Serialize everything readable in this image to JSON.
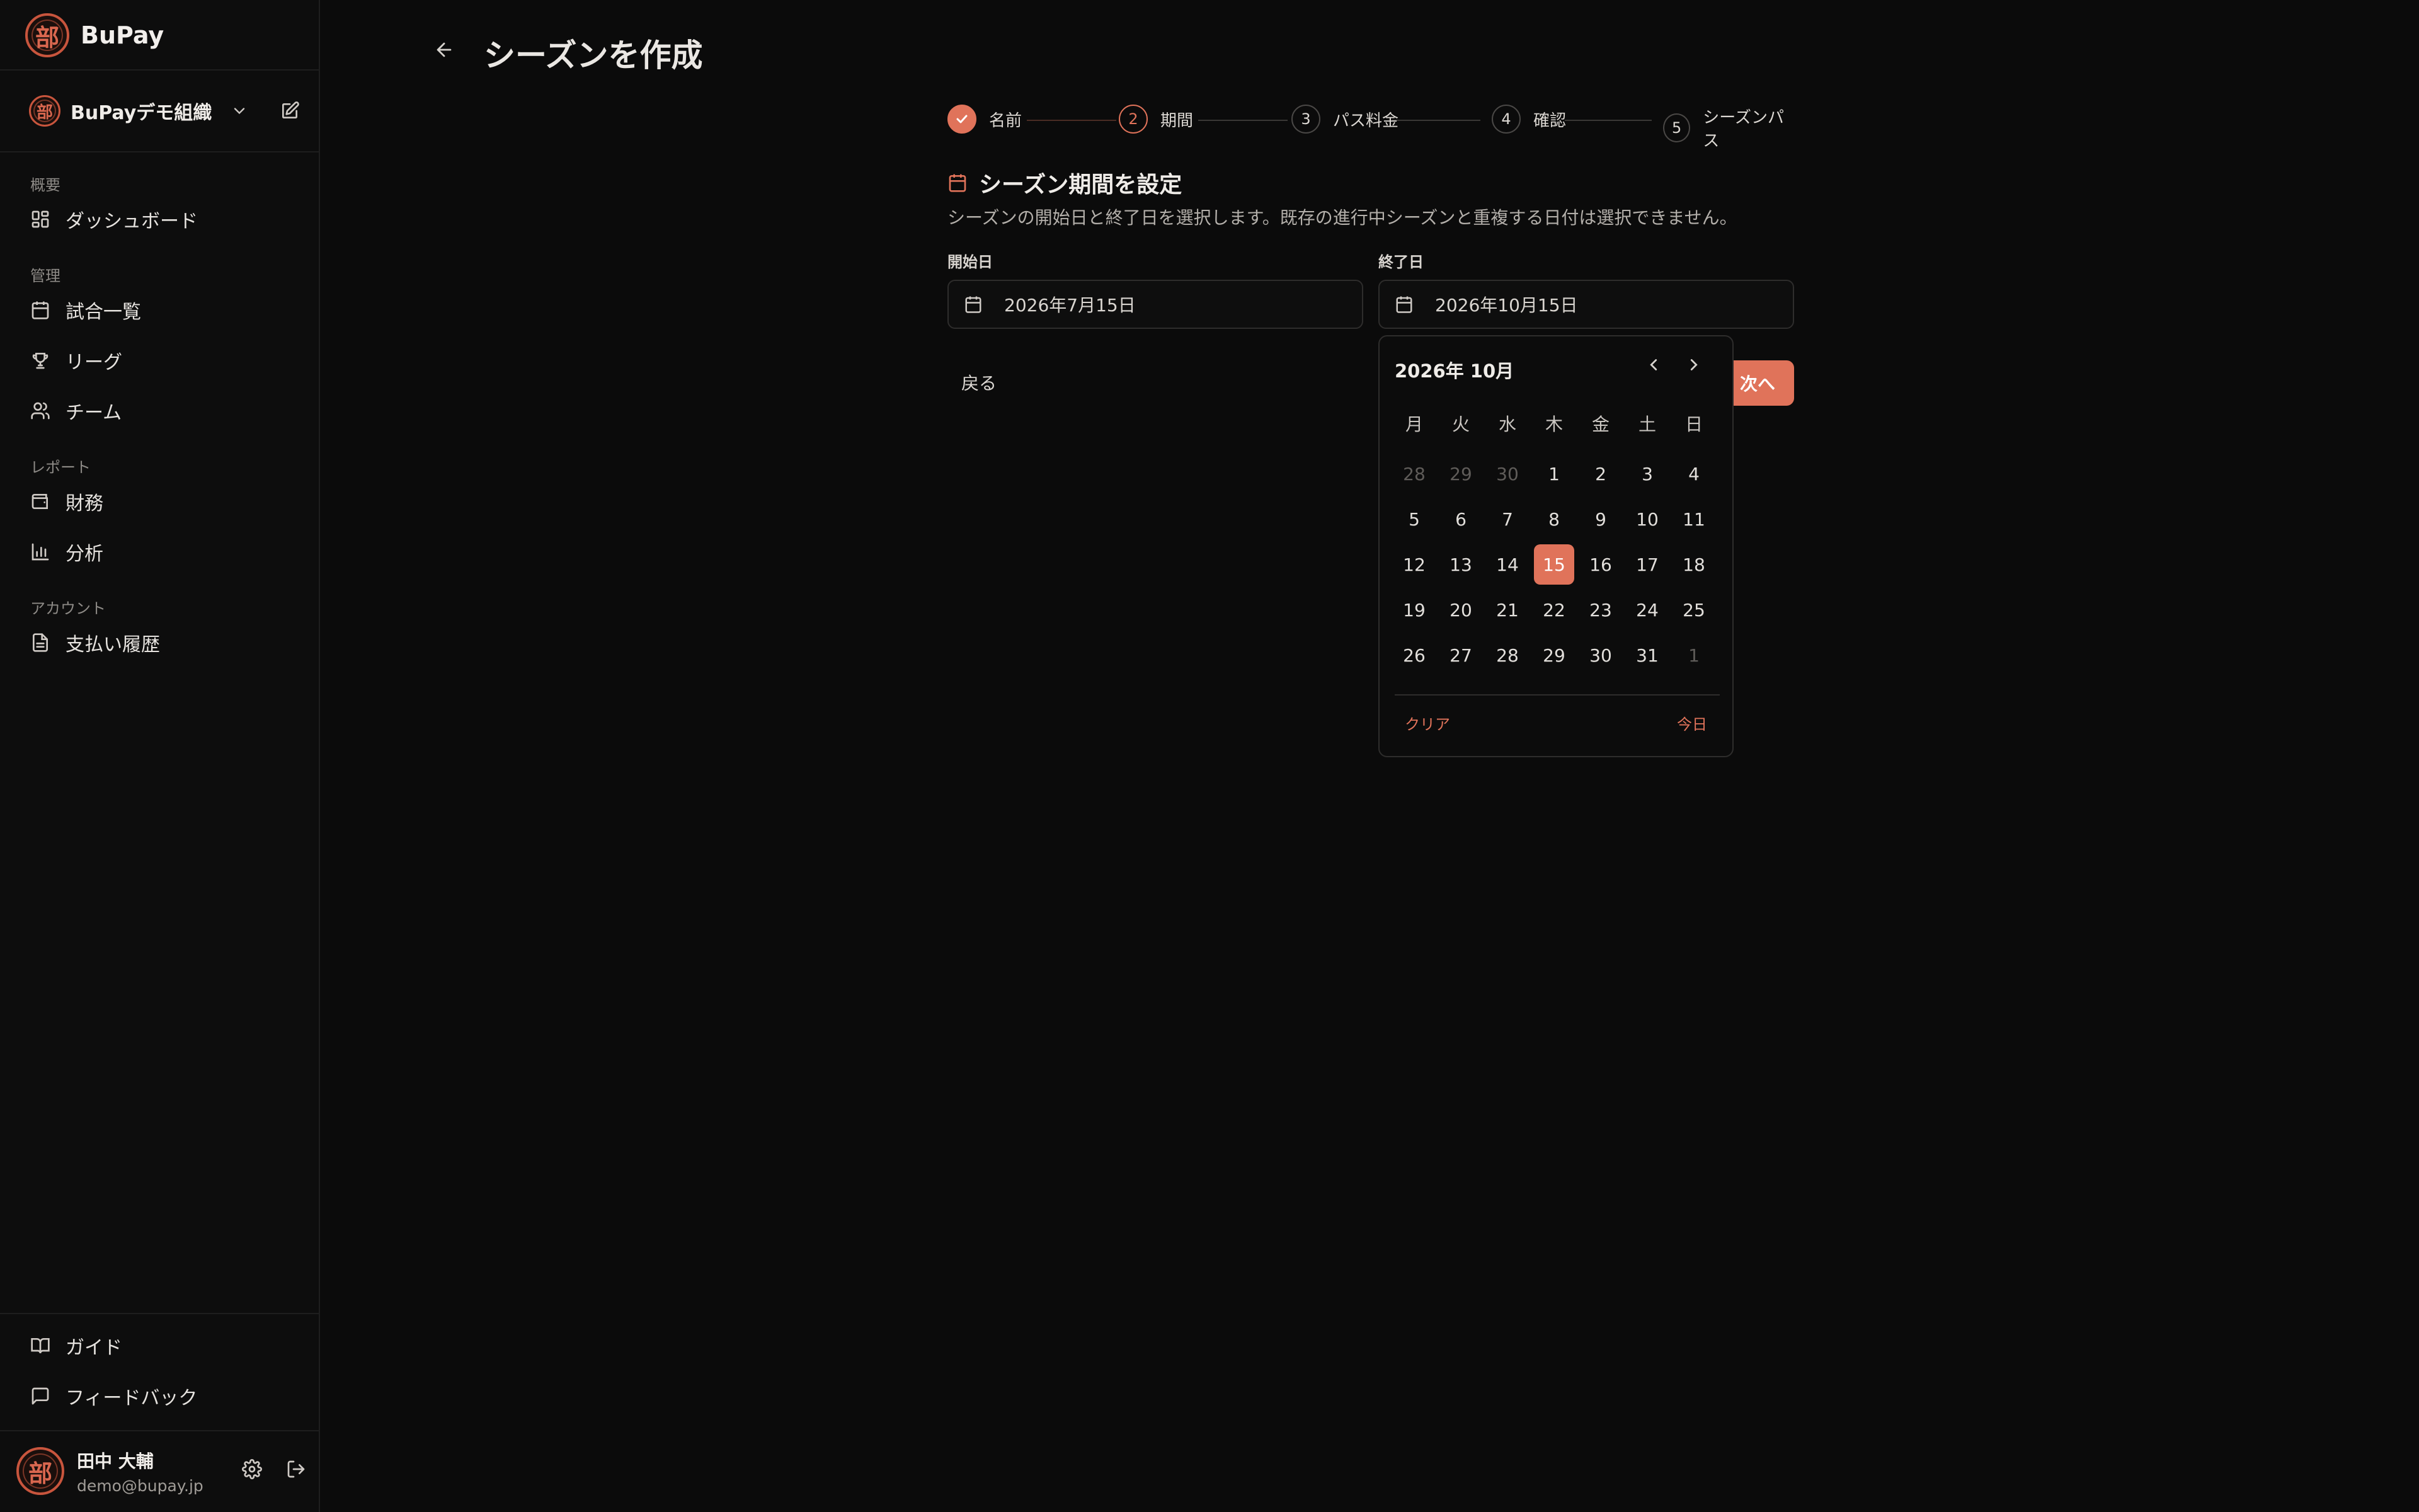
{
  "brand": {
    "name": "BuPay",
    "logo_glyph": "部"
  },
  "org": {
    "name": "BuPayデモ組織"
  },
  "sidebar": {
    "sections": [
      {
        "label": "概要",
        "items": [
          {
            "label": "ダッシュボード",
            "icon": "dashboard-icon"
          }
        ]
      },
      {
        "label": "管理",
        "items": [
          {
            "label": "試合一覧",
            "icon": "calendar-icon"
          },
          {
            "label": "リーグ",
            "icon": "trophy-icon"
          },
          {
            "label": "チーム",
            "icon": "users-icon"
          }
        ]
      },
      {
        "label": "レポート",
        "items": [
          {
            "label": "財務",
            "icon": "wallet-icon"
          },
          {
            "label": "分析",
            "icon": "bar-chart-icon"
          }
        ]
      },
      {
        "label": "アカウント",
        "items": [
          {
            "label": "支払い履歴",
            "icon": "document-icon"
          }
        ]
      }
    ],
    "footer_items": [
      {
        "label": "ガイド",
        "icon": "book-icon"
      },
      {
        "label": "フィードバック",
        "icon": "message-icon"
      }
    ]
  },
  "user": {
    "name": "田中 大輔",
    "email": "demo@bupay.jp"
  },
  "page": {
    "title": "シーズンを作成"
  },
  "steps": [
    {
      "number": "1",
      "label": "名前",
      "state": "done"
    },
    {
      "number": "2",
      "label": "期間",
      "state": "active"
    },
    {
      "number": "3",
      "label": "パス料金",
      "state": "pending"
    },
    {
      "number": "4",
      "label": "確認",
      "state": "pending"
    },
    {
      "number": "5",
      "label": "シーズンパス",
      "state": "pending"
    }
  ],
  "section": {
    "title": "シーズン期間を設定",
    "description": "シーズンの開始日と終了日を選択します。既存の進行中シーズンと重複する日付は選択できません。"
  },
  "start_date": {
    "label": "開始日",
    "value": "2026年7月15日"
  },
  "end_date": {
    "label": "終了日",
    "value": "2026年10月15日"
  },
  "buttons": {
    "back": "戻る",
    "next": "次へ"
  },
  "calendar": {
    "title": "2026年 10月",
    "weekdays": [
      "月",
      "火",
      "水",
      "木",
      "金",
      "土",
      "日"
    ],
    "days": [
      {
        "d": "28",
        "m": true
      },
      {
        "d": "29",
        "m": true
      },
      {
        "d": "30",
        "m": true
      },
      {
        "d": "1"
      },
      {
        "d": "2"
      },
      {
        "d": "3"
      },
      {
        "d": "4"
      },
      {
        "d": "5"
      },
      {
        "d": "6"
      },
      {
        "d": "7"
      },
      {
        "d": "8"
      },
      {
        "d": "9"
      },
      {
        "d": "10"
      },
      {
        "d": "11"
      },
      {
        "d": "12"
      },
      {
        "d": "13"
      },
      {
        "d": "14"
      },
      {
        "d": "15",
        "s": true
      },
      {
        "d": "16"
      },
      {
        "d": "17"
      },
      {
        "d": "18"
      },
      {
        "d": "19"
      },
      {
        "d": "20"
      },
      {
        "d": "21"
      },
      {
        "d": "22"
      },
      {
        "d": "23"
      },
      {
        "d": "24"
      },
      {
        "d": "25"
      },
      {
        "d": "26"
      },
      {
        "d": "27"
      },
      {
        "d": "28"
      },
      {
        "d": "29"
      },
      {
        "d": "30"
      },
      {
        "d": "31"
      },
      {
        "d": "1",
        "m": true
      }
    ],
    "clear_label": "クリア",
    "today_label": "今日"
  },
  "colors": {
    "accent": "#e0735a",
    "background": "#0b0b0b",
    "sidebar": "#0d0d0d"
  }
}
